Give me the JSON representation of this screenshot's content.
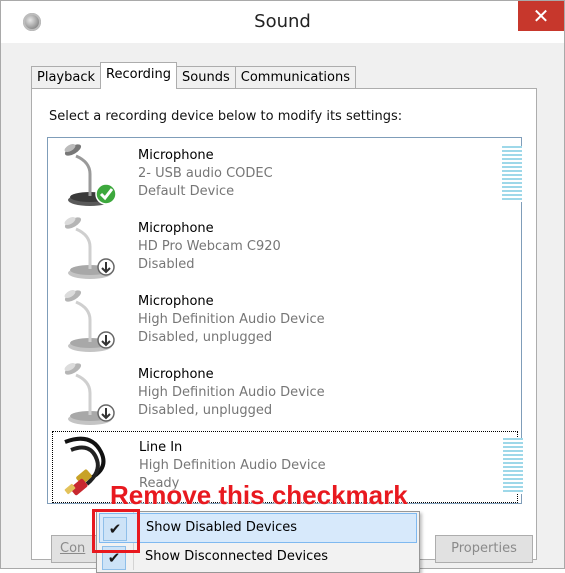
{
  "window": {
    "title": "Sound",
    "close_glyph": "✕"
  },
  "tabs": [
    {
      "label": "Playback"
    },
    {
      "label": "Recording"
    },
    {
      "label": "Sounds"
    },
    {
      "label": "Communications"
    }
  ],
  "active_tab": "Recording",
  "instruction": "Select a recording device below to modify its settings:",
  "devices": [
    {
      "name": "Microphone",
      "description": "2- USB audio CODEC",
      "status": "Default Device",
      "icon": "microphone-default-icon",
      "has_level_meter": true
    },
    {
      "name": "Microphone",
      "description": "HD Pro Webcam C920",
      "status": "Disabled",
      "icon": "microphone-disabled-icon",
      "has_level_meter": false
    },
    {
      "name": "Microphone",
      "description": "High Definition Audio Device",
      "status": "Disabled, unplugged",
      "icon": "microphone-disabled-icon",
      "has_level_meter": false
    },
    {
      "name": "Microphone",
      "description": "High Definition Audio Device",
      "status": "Disabled, unplugged",
      "icon": "microphone-disabled-icon",
      "has_level_meter": false
    },
    {
      "name": "Line In",
      "description": "High Definition Audio Device",
      "status": "Ready",
      "icon": "line-in-cable-icon",
      "has_level_meter": true
    }
  ],
  "annotation": "Remove this checkmark",
  "buttons": {
    "configure_visible": "Con",
    "properties_label": "Properties"
  },
  "context_menu": {
    "items": [
      {
        "label": "Show Disabled Devices",
        "checked": true
      },
      {
        "label": "Show Disconnected Devices",
        "checked": true
      }
    ],
    "check_glyph": "✔"
  },
  "colors": {
    "close_button": "#c7372c",
    "annotation": "#e8191f",
    "menu_hover": "#d7e9fb",
    "level_meter": "#9ed8e9",
    "default_badge": "#3da83d"
  }
}
